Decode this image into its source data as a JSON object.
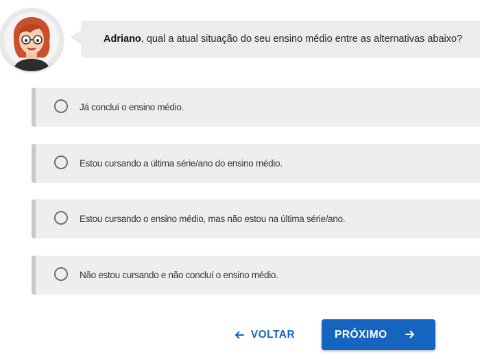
{
  "question": {
    "name": "Adriano",
    "text": ", qual a atual situação do seu ensino médio entre as alternativas abaixo?"
  },
  "avatar": {
    "icon": "assistant-avatar-icon"
  },
  "options": [
    {
      "label": "Já concluí o ensino médio."
    },
    {
      "label": "Estou cursando a última série/ano do ensino médio."
    },
    {
      "label": "Estou cursando o ensino médio, mas não estou na última série/ano."
    },
    {
      "label": "Não estou cursando e não concluí o ensino médio."
    }
  ],
  "navigation": {
    "back_label": "VOLTAR",
    "next_label": "PRÓXIMO",
    "back_icon": "arrow-left-icon",
    "next_icon": "arrow-right-icon"
  },
  "colors": {
    "accent": "#1565c0",
    "option_background": "#eeeeee",
    "option_border": "#c9c9c9",
    "bubble_background": "#ececec"
  }
}
